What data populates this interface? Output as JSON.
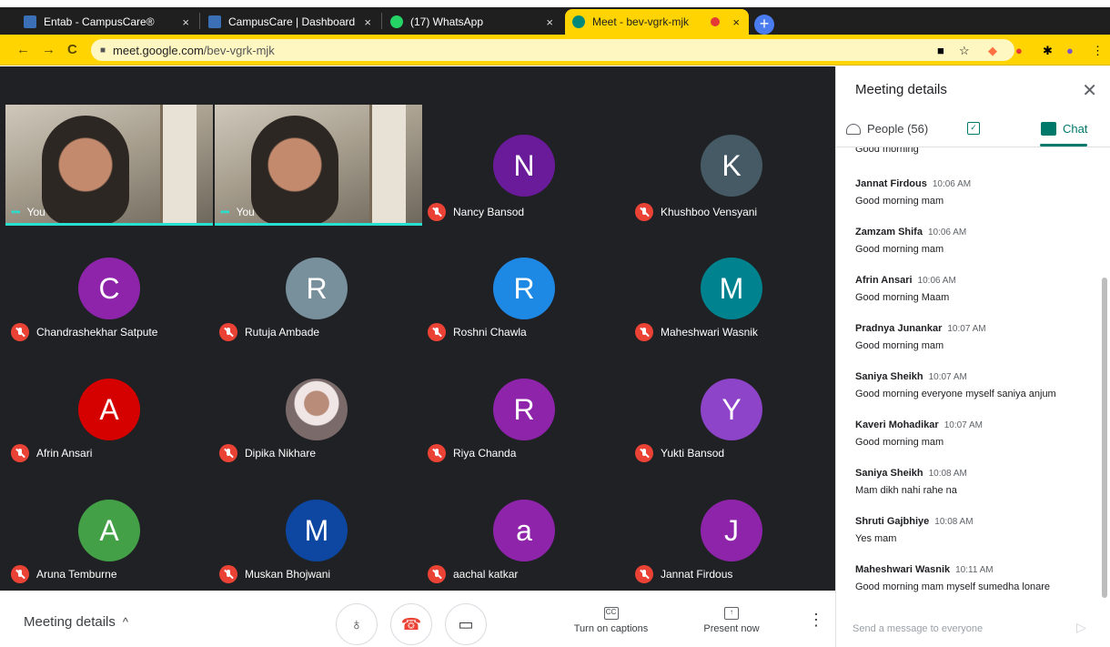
{
  "browser": {
    "tabs": [
      {
        "title": "Entab - CampusCare®",
        "active": false,
        "favicon_color": "#3b6fb6"
      },
      {
        "title": "CampusCare | Dashboard",
        "active": false,
        "favicon_color": "#3b6fb6"
      },
      {
        "title": "(17) WhatsApp",
        "active": false,
        "favicon_color": "#25d366"
      },
      {
        "title": "Meet - bev-vgrk-mjk",
        "active": true,
        "favicon_color": "#00897b"
      }
    ],
    "close_symbol": "×",
    "new_tab_symbol": "+",
    "url_host": "meet.google.com",
    "url_path": "/bev-vgrk-mjk"
  },
  "participants": [
    {
      "name": "You",
      "avatar": "camera",
      "muted": false
    },
    {
      "name": "You",
      "avatar": "camera",
      "muted": false
    },
    {
      "name": "Nancy Bansod",
      "initial": "N",
      "color": "#6a1b9a",
      "muted": true
    },
    {
      "name": "Khushboo Vensyani",
      "initial": "K",
      "color": "#455a64",
      "muted": true
    },
    {
      "name": "Chandrashekhar Satpute",
      "initial": "C",
      "color": "#8e24aa",
      "muted": true
    },
    {
      "name": "Rutuja Ambade",
      "initial": "R",
      "color": "#78909c",
      "muted": true
    },
    {
      "name": "Roshni Chawla",
      "initial": "R",
      "color": "#1e88e5",
      "muted": true
    },
    {
      "name": "Maheshwari Wasnik",
      "initial": "M",
      "color": "#00838f",
      "muted": true
    },
    {
      "name": "Afrin Ansari",
      "initial": "A",
      "color": "#d50000",
      "muted": true
    },
    {
      "name": "Dipika Nikhare",
      "avatar": "photo",
      "muted": true
    },
    {
      "name": "Riya Chanda",
      "initial": "R",
      "color": "#8e24aa",
      "muted": true
    },
    {
      "name": "Yukti Bansod",
      "initial": "Y",
      "color": "#8e44c9",
      "muted": true
    },
    {
      "name": "Aruna Temburne",
      "initial": "A",
      "color": "#43a047",
      "muted": true
    },
    {
      "name": "Muskan Bhojwani",
      "initial": "M",
      "color": "#0d47a1",
      "muted": true
    },
    {
      "name": "aachal katkar",
      "initial": "a",
      "color": "#8e24aa",
      "muted": true
    },
    {
      "name": "Jannat Firdous",
      "initial": "J",
      "color": "#8e24aa",
      "muted": true
    }
  ],
  "bottom_bar": {
    "meeting_details_label": "Meeting details",
    "captions_label": "Turn on captions",
    "present_label": "Present now"
  },
  "sidebar": {
    "title": "Meeting details",
    "people_tab": "People (56)",
    "chat_tab": "Chat",
    "cut_message": "Good morning",
    "messages": [
      {
        "sender": "Jannat Firdous",
        "time": "10:06 AM",
        "text": "Good morning mam"
      },
      {
        "sender": "Zamzam Shifa",
        "time": "10:06 AM",
        "text": "Good morning mam"
      },
      {
        "sender": "Afrin Ansari",
        "time": "10:06 AM",
        "text": "Good morning Maam"
      },
      {
        "sender": "Pradnya Junankar",
        "time": "10:07 AM",
        "text": "Good morning mam"
      },
      {
        "sender": "Saniya Sheikh",
        "time": "10:07 AM",
        "text": "Good morning everyone myself saniya anjum"
      },
      {
        "sender": "Kaveri Mohadikar",
        "time": "10:07 AM",
        "text": "Good morning mam"
      },
      {
        "sender": "Saniya Sheikh",
        "time": "10:08 AM",
        "text": "Mam dikh nahi rahe na"
      },
      {
        "sender": "Shruti Gajbhiye",
        "time": "10:08 AM",
        "text": "Yes mam"
      },
      {
        "sender": "Maheshwari Wasnik",
        "time": "10:11 AM",
        "text": "Good morning mam myself sumedha lonare"
      }
    ],
    "composer_placeholder": "Send a message to everyone"
  },
  "colors": {
    "accent": "#00796b",
    "toolbar": "#ffd400",
    "mute": "#ea4335"
  }
}
